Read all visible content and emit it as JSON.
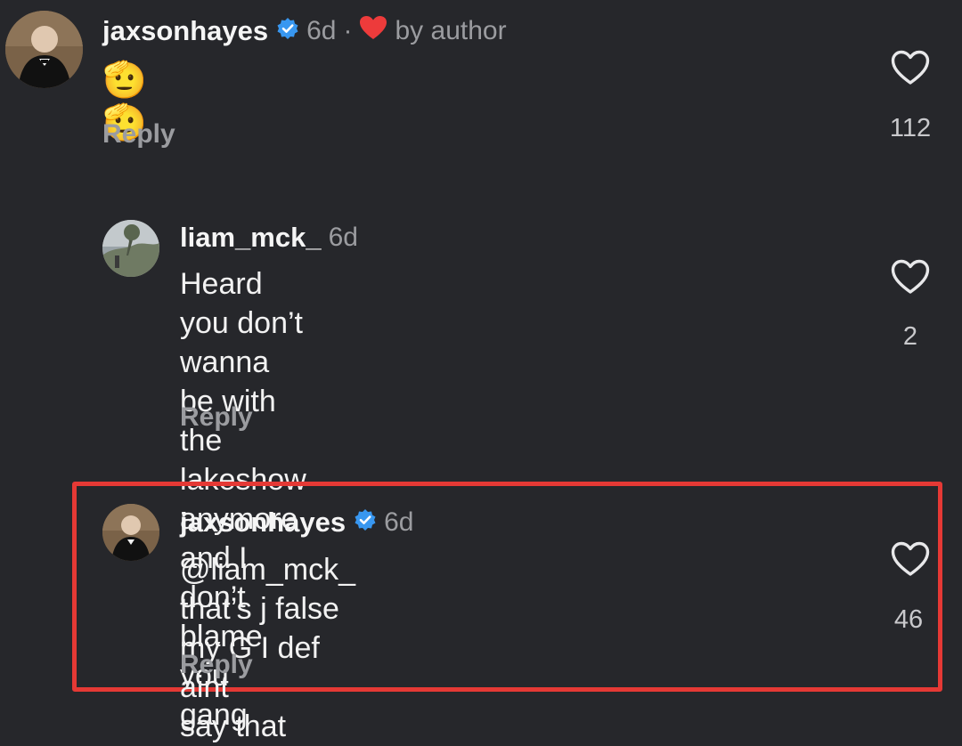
{
  "comments": [
    {
      "username": "jaxsonhayes",
      "verified": true,
      "time": "6d",
      "author_like_label": "by author",
      "text": "🫡🫡",
      "reply_label": "Reply",
      "like_count": "112"
    },
    {
      "username": "liam_mck_",
      "verified": false,
      "time": "6d",
      "text": "Heard you don’t wanna be with the\nlakeshow anymore and I don’t blame you\ngang",
      "reply_label": "Reply",
      "like_count": "2"
    },
    {
      "username": "jaxsonhayes",
      "verified": true,
      "time": "6d",
      "text": "@liam_mck_  that’s j false my G I def aint\nsay that",
      "reply_label": "Reply",
      "like_count": "46"
    }
  ],
  "colors": {
    "background": "#26272b",
    "verified_badge": "#3897f0",
    "author_heart": "#ed3b3b",
    "highlight_border": "#e53935"
  },
  "icons": {
    "like": "heart-outline-icon",
    "verified": "verified-badge-icon",
    "author_heart": "heart-filled-icon"
  }
}
